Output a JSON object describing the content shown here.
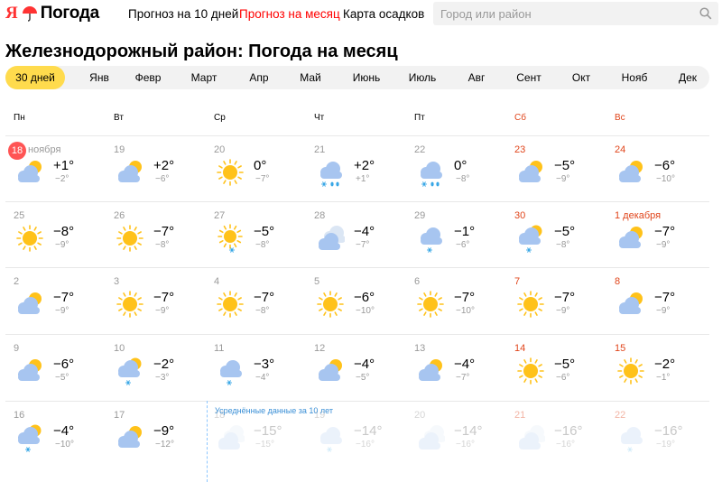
{
  "header": {
    "logo_mark": "Я",
    "logo_text": "Погода",
    "nav": [
      "Прогноз на 10 дней",
      "Прогноз на месяц",
      "Карта осадков"
    ],
    "active_nav": 1,
    "search_placeholder": "Город или район"
  },
  "title": "Железнодорожный район: Погода на месяц",
  "tabs": [
    "30 дней",
    "Янв",
    "Февр",
    "Март",
    "Апр",
    "Май",
    "Июнь",
    "Июль",
    "Авг",
    "Сент",
    "Окт",
    "Нояб",
    "Дек"
  ],
  "active_tab": 0,
  "weekdays": [
    "Пн",
    "Вт",
    "Ср",
    "Чт",
    "Пт",
    "Сб",
    "Вс"
  ],
  "average_note": "Усреднённые данные за 10 лет",
  "colors": {
    "accent_red": "#f00",
    "weekend": "#e0451b",
    "tab_active": "#ffdb4d",
    "sun": "#ffc21a",
    "cloud": "#a7c5f0",
    "note_blue": "#3a8fd6"
  },
  "rows": [
    [
      {
        "date": "18",
        "month": "ноября",
        "today": true,
        "icon": "partly-cloudy-icon",
        "tmax": "+1°",
        "tmin": "−2°"
      },
      {
        "date": "19",
        "icon": "partly-cloudy-icon",
        "tmax": "+2°",
        "tmin": "−6°"
      },
      {
        "date": "20",
        "icon": "sun-icon",
        "tmax": "0°",
        "tmin": "−7°"
      },
      {
        "date": "21",
        "icon": "cloud-sleet-icon",
        "tmax": "+2°",
        "tmin": "+1°"
      },
      {
        "date": "22",
        "icon": "cloud-sleet-icon",
        "tmax": "0°",
        "tmin": "−8°"
      },
      {
        "date": "23",
        "icon": "partly-cloudy-icon",
        "tmax": "−5°",
        "tmin": "−9°"
      },
      {
        "date": "24",
        "icon": "partly-cloudy-icon",
        "tmax": "−6°",
        "tmin": "−10°"
      }
    ],
    [
      {
        "date": "25",
        "icon": "sun-icon",
        "tmax": "−8°",
        "tmin": "−9°"
      },
      {
        "date": "26",
        "icon": "sun-icon",
        "tmax": "−7°",
        "tmin": "−8°"
      },
      {
        "date": "27",
        "icon": "sun-snow-icon",
        "tmax": "−5°",
        "tmin": "−8°"
      },
      {
        "date": "28",
        "icon": "overcast-icon",
        "tmax": "−4°",
        "tmin": "−7°"
      },
      {
        "date": "29",
        "icon": "cloud-snow-icon",
        "tmax": "−1°",
        "tmin": "−6°"
      },
      {
        "date": "30",
        "icon": "partly-cloudy-snow-icon",
        "tmax": "−5°",
        "tmin": "−8°"
      },
      {
        "date": "1 декабря",
        "icon": "partly-cloudy-icon",
        "tmax": "−7°",
        "tmin": "−9°"
      }
    ],
    [
      {
        "date": "2",
        "icon": "partly-cloudy-icon",
        "tmax": "−7°",
        "tmin": "−9°"
      },
      {
        "date": "3",
        "icon": "sun-icon",
        "tmax": "−7°",
        "tmin": "−9°"
      },
      {
        "date": "4",
        "icon": "sun-icon",
        "tmax": "−7°",
        "tmin": "−8°"
      },
      {
        "date": "5",
        "icon": "sun-icon",
        "tmax": "−6°",
        "tmin": "−10°"
      },
      {
        "date": "6",
        "icon": "sun-icon",
        "tmax": "−7°",
        "tmin": "−10°"
      },
      {
        "date": "7",
        "icon": "sun-icon",
        "tmax": "−7°",
        "tmin": "−9°"
      },
      {
        "date": "8",
        "icon": "partly-cloudy-icon",
        "tmax": "−7°",
        "tmin": "−9°"
      }
    ],
    [
      {
        "date": "9",
        "icon": "partly-cloudy-icon",
        "tmax": "−6°",
        "tmin": "−5°"
      },
      {
        "date": "10",
        "icon": "partly-cloudy-snow-icon",
        "tmax": "−2°",
        "tmin": "−3°"
      },
      {
        "date": "11",
        "icon": "cloud-snow-icon",
        "tmax": "−3°",
        "tmin": "−4°"
      },
      {
        "date": "12",
        "icon": "partly-cloudy-icon",
        "tmax": "−4°",
        "tmin": "−5°"
      },
      {
        "date": "13",
        "icon": "partly-cloudy-icon",
        "tmax": "−4°",
        "tmin": "−7°"
      },
      {
        "date": "14",
        "icon": "sun-icon",
        "tmax": "−5°",
        "tmin": "−6°"
      },
      {
        "date": "15",
        "icon": "sun-icon",
        "tmax": "−2°",
        "tmin": "−1°"
      }
    ],
    [
      {
        "date": "16",
        "icon": "partly-cloudy-snow-icon",
        "tmax": "−4°",
        "tmin": "−10°"
      },
      {
        "date": "17",
        "icon": "partly-cloudy-icon",
        "tmax": "−9°",
        "tmin": "−12°"
      },
      {
        "date": "18",
        "icon": "overcast-icon",
        "tmax": "−15°",
        "tmin": "−15°",
        "faded": true
      },
      {
        "date": "19",
        "icon": "cloud-snow-icon",
        "tmax": "−14°",
        "tmin": "−16°",
        "faded": true
      },
      {
        "date": "20",
        "icon": "overcast-icon",
        "tmax": "−14°",
        "tmin": "−16°",
        "faded": true
      },
      {
        "date": "21",
        "icon": "overcast-icon",
        "tmax": "−16°",
        "tmin": "−16°",
        "faded": true
      },
      {
        "date": "22",
        "icon": "cloud-snow-icon",
        "tmax": "−16°",
        "tmin": "−19°",
        "faded": true
      }
    ]
  ]
}
